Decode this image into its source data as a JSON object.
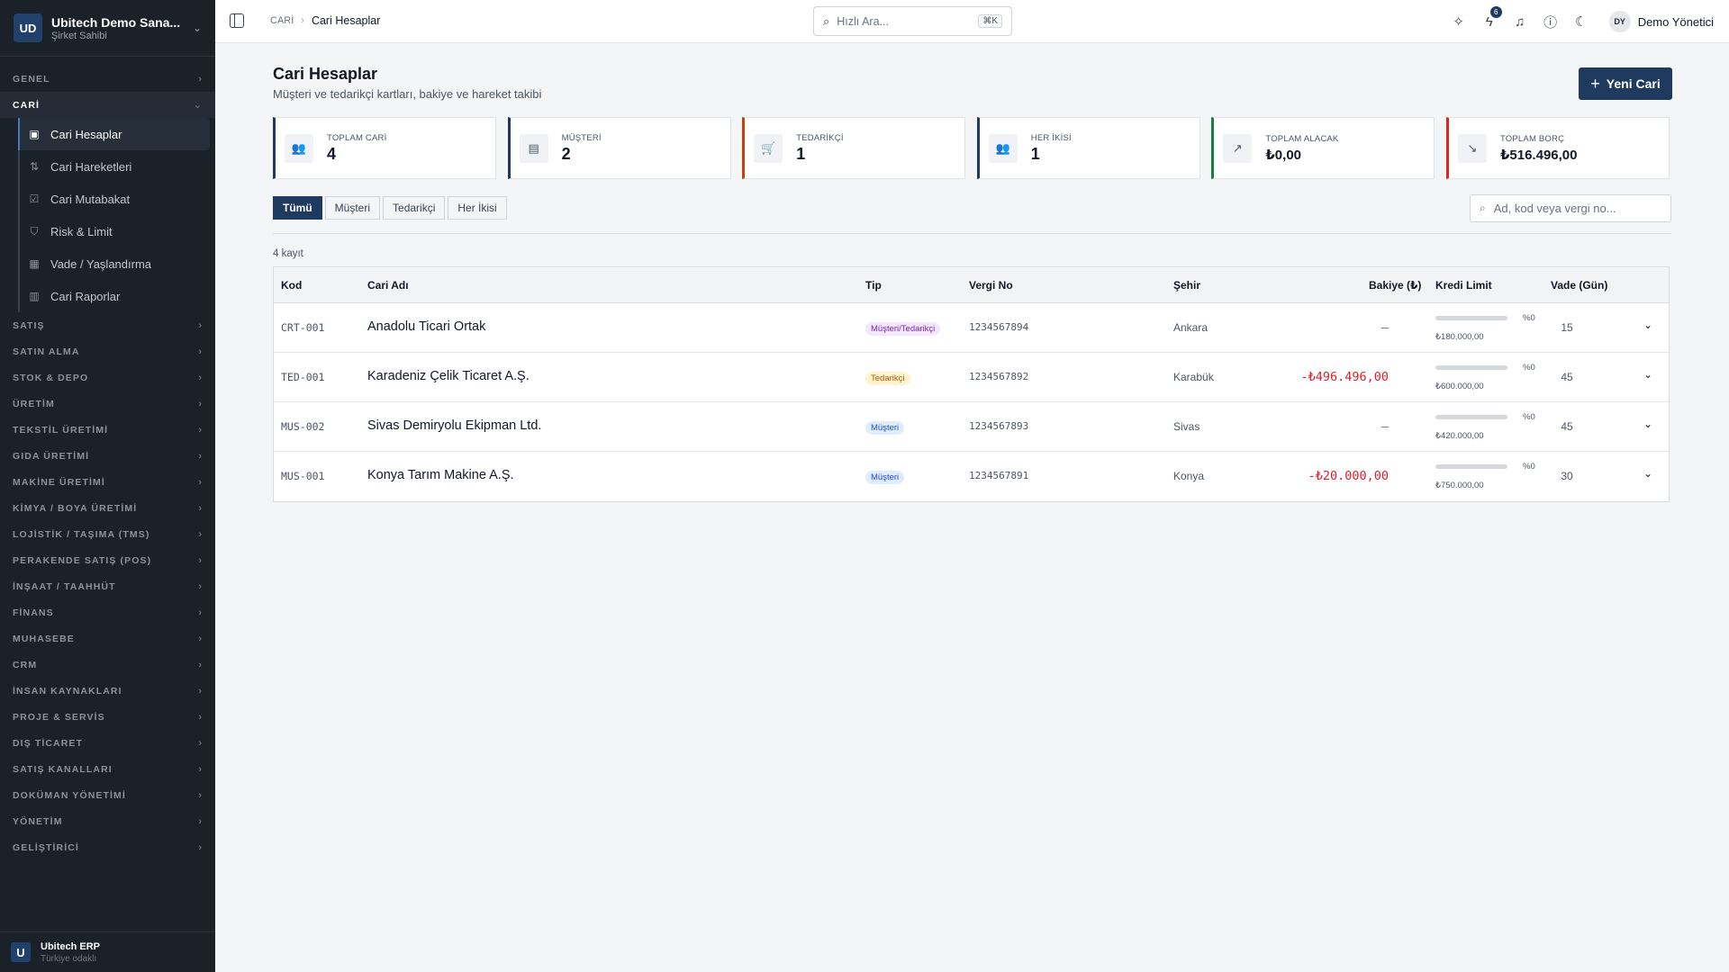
{
  "workspace": {
    "initials": "UD",
    "name": "Ubitech Demo Sana...",
    "role": "Şirket Sahibi"
  },
  "sidebar": {
    "sections_top": [
      {
        "label": "GENEL"
      }
    ],
    "active_section": {
      "label": "CARİ"
    },
    "sub_items": [
      {
        "label": "Cari Hesaplar",
        "icon": "user-card-icon",
        "glyph": "▣"
      },
      {
        "label": "Cari Hareketleri",
        "icon": "arrows-updown-icon",
        "glyph": "⇅"
      },
      {
        "label": "Cari Mutabakat",
        "icon": "checkbox-icon",
        "glyph": "☑"
      },
      {
        "label": "Risk & Limit",
        "icon": "shield-check-icon",
        "glyph": "⛉"
      },
      {
        "label": "Vade / Yaşlandırma",
        "icon": "calendar-icon",
        "glyph": "▦"
      },
      {
        "label": "Cari Raporlar",
        "icon": "bar-chart-icon",
        "glyph": "▥"
      }
    ],
    "sections_bottom": [
      {
        "label": "SATIŞ"
      },
      {
        "label": "SATIN ALMA"
      },
      {
        "label": "STOK & DEPO"
      },
      {
        "label": "ÜRETİM"
      },
      {
        "label": "TEKSTİL ÜRETİMİ"
      },
      {
        "label": "GIDA ÜRETİMİ"
      },
      {
        "label": "MAKİNE ÜRETİMİ"
      },
      {
        "label": "KİMYA / BOYA ÜRETİMİ"
      },
      {
        "label": "LOJİSTİK / TAŞIMA (TMS)"
      },
      {
        "label": "PERAKENDE SATIŞ (POS)"
      },
      {
        "label": "İNŞAAT / TAAHHÜT"
      },
      {
        "label": "FİNANS"
      },
      {
        "label": "MUHASEBE"
      },
      {
        "label": "CRM"
      },
      {
        "label": "İNSAN KAYNAKLARI"
      },
      {
        "label": "PROJE & SERVİS"
      },
      {
        "label": "DIŞ TİCARET"
      },
      {
        "label": "SATIŞ KANALLARI"
      },
      {
        "label": "DOKÜMAN YÖNETİMİ"
      },
      {
        "label": "YÖNETİM"
      },
      {
        "label": "GELİŞTİRİCİ"
      }
    ],
    "footer": {
      "logo": "U",
      "name": "Ubitech ERP",
      "sub": "Türkiye odaklı"
    }
  },
  "topbar": {
    "breadcrumb": [
      "CARİ",
      "Cari Hesaplar"
    ],
    "search_placeholder": "Hızlı Ara...",
    "search_shortcut": "⌘K",
    "notification_count": "6",
    "user_initials": "DY",
    "user_name": "Demo Yönetici"
  },
  "page": {
    "title": "Cari Hesaplar",
    "subtitle": "Müşteri ve tedarikçi kartları, bakiye ve hareket takibi",
    "new_button": "Yeni Cari"
  },
  "stats": [
    {
      "label": "TOPLAM CARİ",
      "value": "4",
      "icon": "users-icon",
      "color": "#1e3a5f"
    },
    {
      "label": "MÜŞTERİ",
      "value": "2",
      "icon": "building-icon",
      "color": "#1e3a5f"
    },
    {
      "label": "TEDARİKÇİ",
      "value": "1",
      "icon": "cart-icon",
      "color": "#c2410c"
    },
    {
      "label": "HER İKİSİ",
      "value": "1",
      "icon": "users-icon",
      "color": "#1e3a5f"
    },
    {
      "label": "TOPLAM ALACAK",
      "value": "₺0,00",
      "icon": "trend-up-icon",
      "color": "#15803d"
    },
    {
      "label": "TOPLAM BORÇ",
      "value": "₺516.496,00",
      "icon": "trend-down-icon",
      "color": "#dc2626"
    }
  ],
  "filters": {
    "tabs": [
      "Tümü",
      "Müşteri",
      "Tedarikçi",
      "Her İkisi"
    ],
    "active": "Tümü",
    "search_placeholder": "Ad, kod veya vergi no..."
  },
  "table": {
    "count_label": "4 kayıt",
    "headers": {
      "code": "Kod",
      "name": "Cari Adı",
      "type": "Tip",
      "tax": "Vergi No",
      "city": "Şehir",
      "balance": "Bakiye (₺)",
      "credit": "Kredi Limit",
      "term": "Vade (Gün)"
    },
    "rows": [
      {
        "code": "CRT-001",
        "name": "Anadolu Ticari Ortak",
        "type": "Müşteri/Tedarikçi",
        "type_class": "mt",
        "tax": "1234567894",
        "city": "Ankara",
        "balance": "—",
        "balance_class": "zero",
        "credit_pct": "%0",
        "credit_used": 0,
        "credit_limit": "₺180.000,00",
        "term": "15"
      },
      {
        "code": "TED-001",
        "name": "Karadeniz Çelik Ticaret A.Ş.",
        "type": "Tedarikçi",
        "type_class": "td2",
        "tax": "1234567892",
        "city": "Karabük",
        "balance": "-₺496.496,00",
        "balance_class": "neg",
        "credit_pct": "%0",
        "credit_used": 0,
        "credit_limit": "₺600.000,00",
        "term": "45"
      },
      {
        "code": "MUS-002",
        "name": "Sivas Demiryolu Ekipman Ltd.",
        "type": "Müşteri",
        "type_class": "m",
        "tax": "1234567893",
        "city": "Sivas",
        "balance": "—",
        "balance_class": "zero",
        "credit_pct": "%0",
        "credit_used": 0,
        "credit_limit": "₺420.000,00",
        "term": "45"
      },
      {
        "code": "MUS-001",
        "name": "Konya Tarım Makine A.Ş.",
        "type": "Müşteri",
        "type_class": "m",
        "tax": "1234567891",
        "city": "Konya",
        "balance": "-₺20.000,00",
        "balance_class": "neg",
        "credit_pct": "%0",
        "credit_used": 0,
        "credit_limit": "₺750.000,00",
        "term": "30"
      }
    ]
  }
}
